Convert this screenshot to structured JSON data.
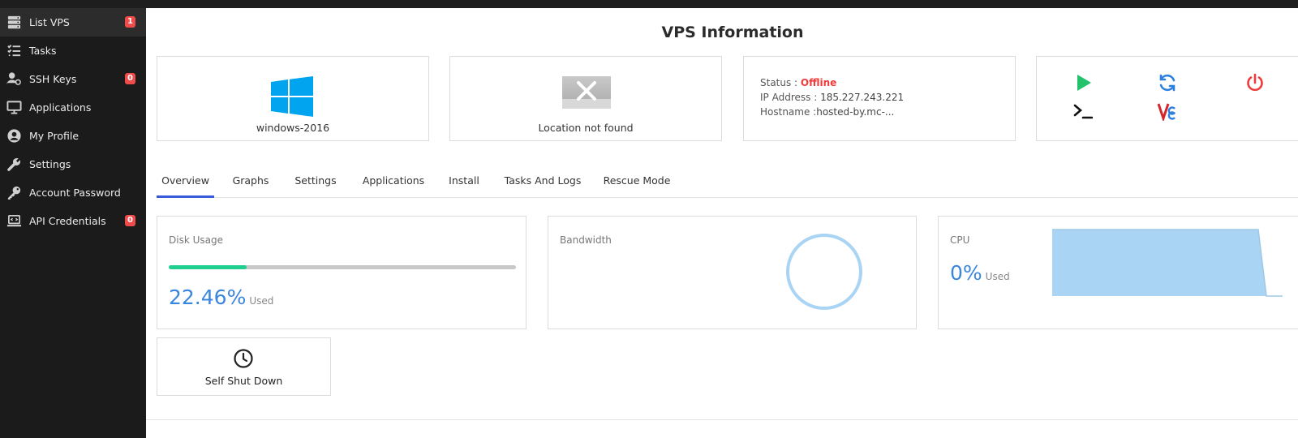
{
  "sidebar": {
    "items": [
      {
        "label": "List VPS",
        "icon": "server-icon",
        "badge": "1",
        "active": true
      },
      {
        "label": "Tasks",
        "icon": "tasks-list-icon",
        "badge": null
      },
      {
        "label": "SSH Keys",
        "icon": "user-key-icon",
        "badge": "0"
      },
      {
        "label": "Applications",
        "icon": "monitor-icon",
        "badge": null
      },
      {
        "label": "My Profile",
        "icon": "user-circle-icon",
        "badge": null
      },
      {
        "label": "Settings",
        "icon": "wrench-icon",
        "badge": null
      },
      {
        "label": "Account Password",
        "icon": "key-icon",
        "badge": null
      },
      {
        "label": "API Credentials",
        "icon": "laptop-code-icon",
        "badge": "0"
      }
    ]
  },
  "page": {
    "title": "VPS Information"
  },
  "os": {
    "name": "windows-2016",
    "icon": "windows-logo-icon",
    "color": "#00a4ef"
  },
  "location": {
    "text": "Location not found",
    "icon": "location-placeholder-icon"
  },
  "info": {
    "status_label": "Status : ",
    "status_value": "Offline",
    "ip_label": "IP Address : ",
    "ip_value": "185.227.243.221",
    "hostname_label": "Hostname :",
    "hostname_value": "hosted-by.mc-..."
  },
  "actions": [
    {
      "name": "start",
      "icon": "play-icon",
      "color": "#22c36b"
    },
    {
      "name": "restart",
      "icon": "refresh-icon",
      "color": "#2d7fe0"
    },
    {
      "name": "power-off",
      "icon": "power-icon",
      "color": "#ef3b3b"
    },
    {
      "name": "console",
      "icon": "terminal-icon",
      "color": "#111111"
    },
    {
      "name": "vnc",
      "icon": "vnc-icon",
      "color": "#d6252b"
    }
  ],
  "tabs": [
    {
      "label": "Overview",
      "active": true
    },
    {
      "label": "Graphs"
    },
    {
      "label": "Settings"
    },
    {
      "label": "Applications"
    },
    {
      "label": "Install"
    },
    {
      "label": "Tasks And Logs"
    },
    {
      "label": "Rescue Mode"
    }
  ],
  "disk": {
    "label": "Disk Usage",
    "value": "22.46%",
    "used_label": "Used",
    "percent": 22.46
  },
  "bandwidth": {
    "label": "Bandwidth"
  },
  "cpu": {
    "label": "CPU",
    "value": "0%",
    "used_label": "Used"
  },
  "self_shutdown": {
    "label": "Self Shut Down",
    "icon": "clock-icon"
  },
  "colors": {
    "accent": "#3a5bd9",
    "value_blue": "#3b86dd",
    "progress_green": "#1fcf8f",
    "badge_red": "#ef4b4b",
    "sidebar_bg": "#1b1b1b"
  }
}
